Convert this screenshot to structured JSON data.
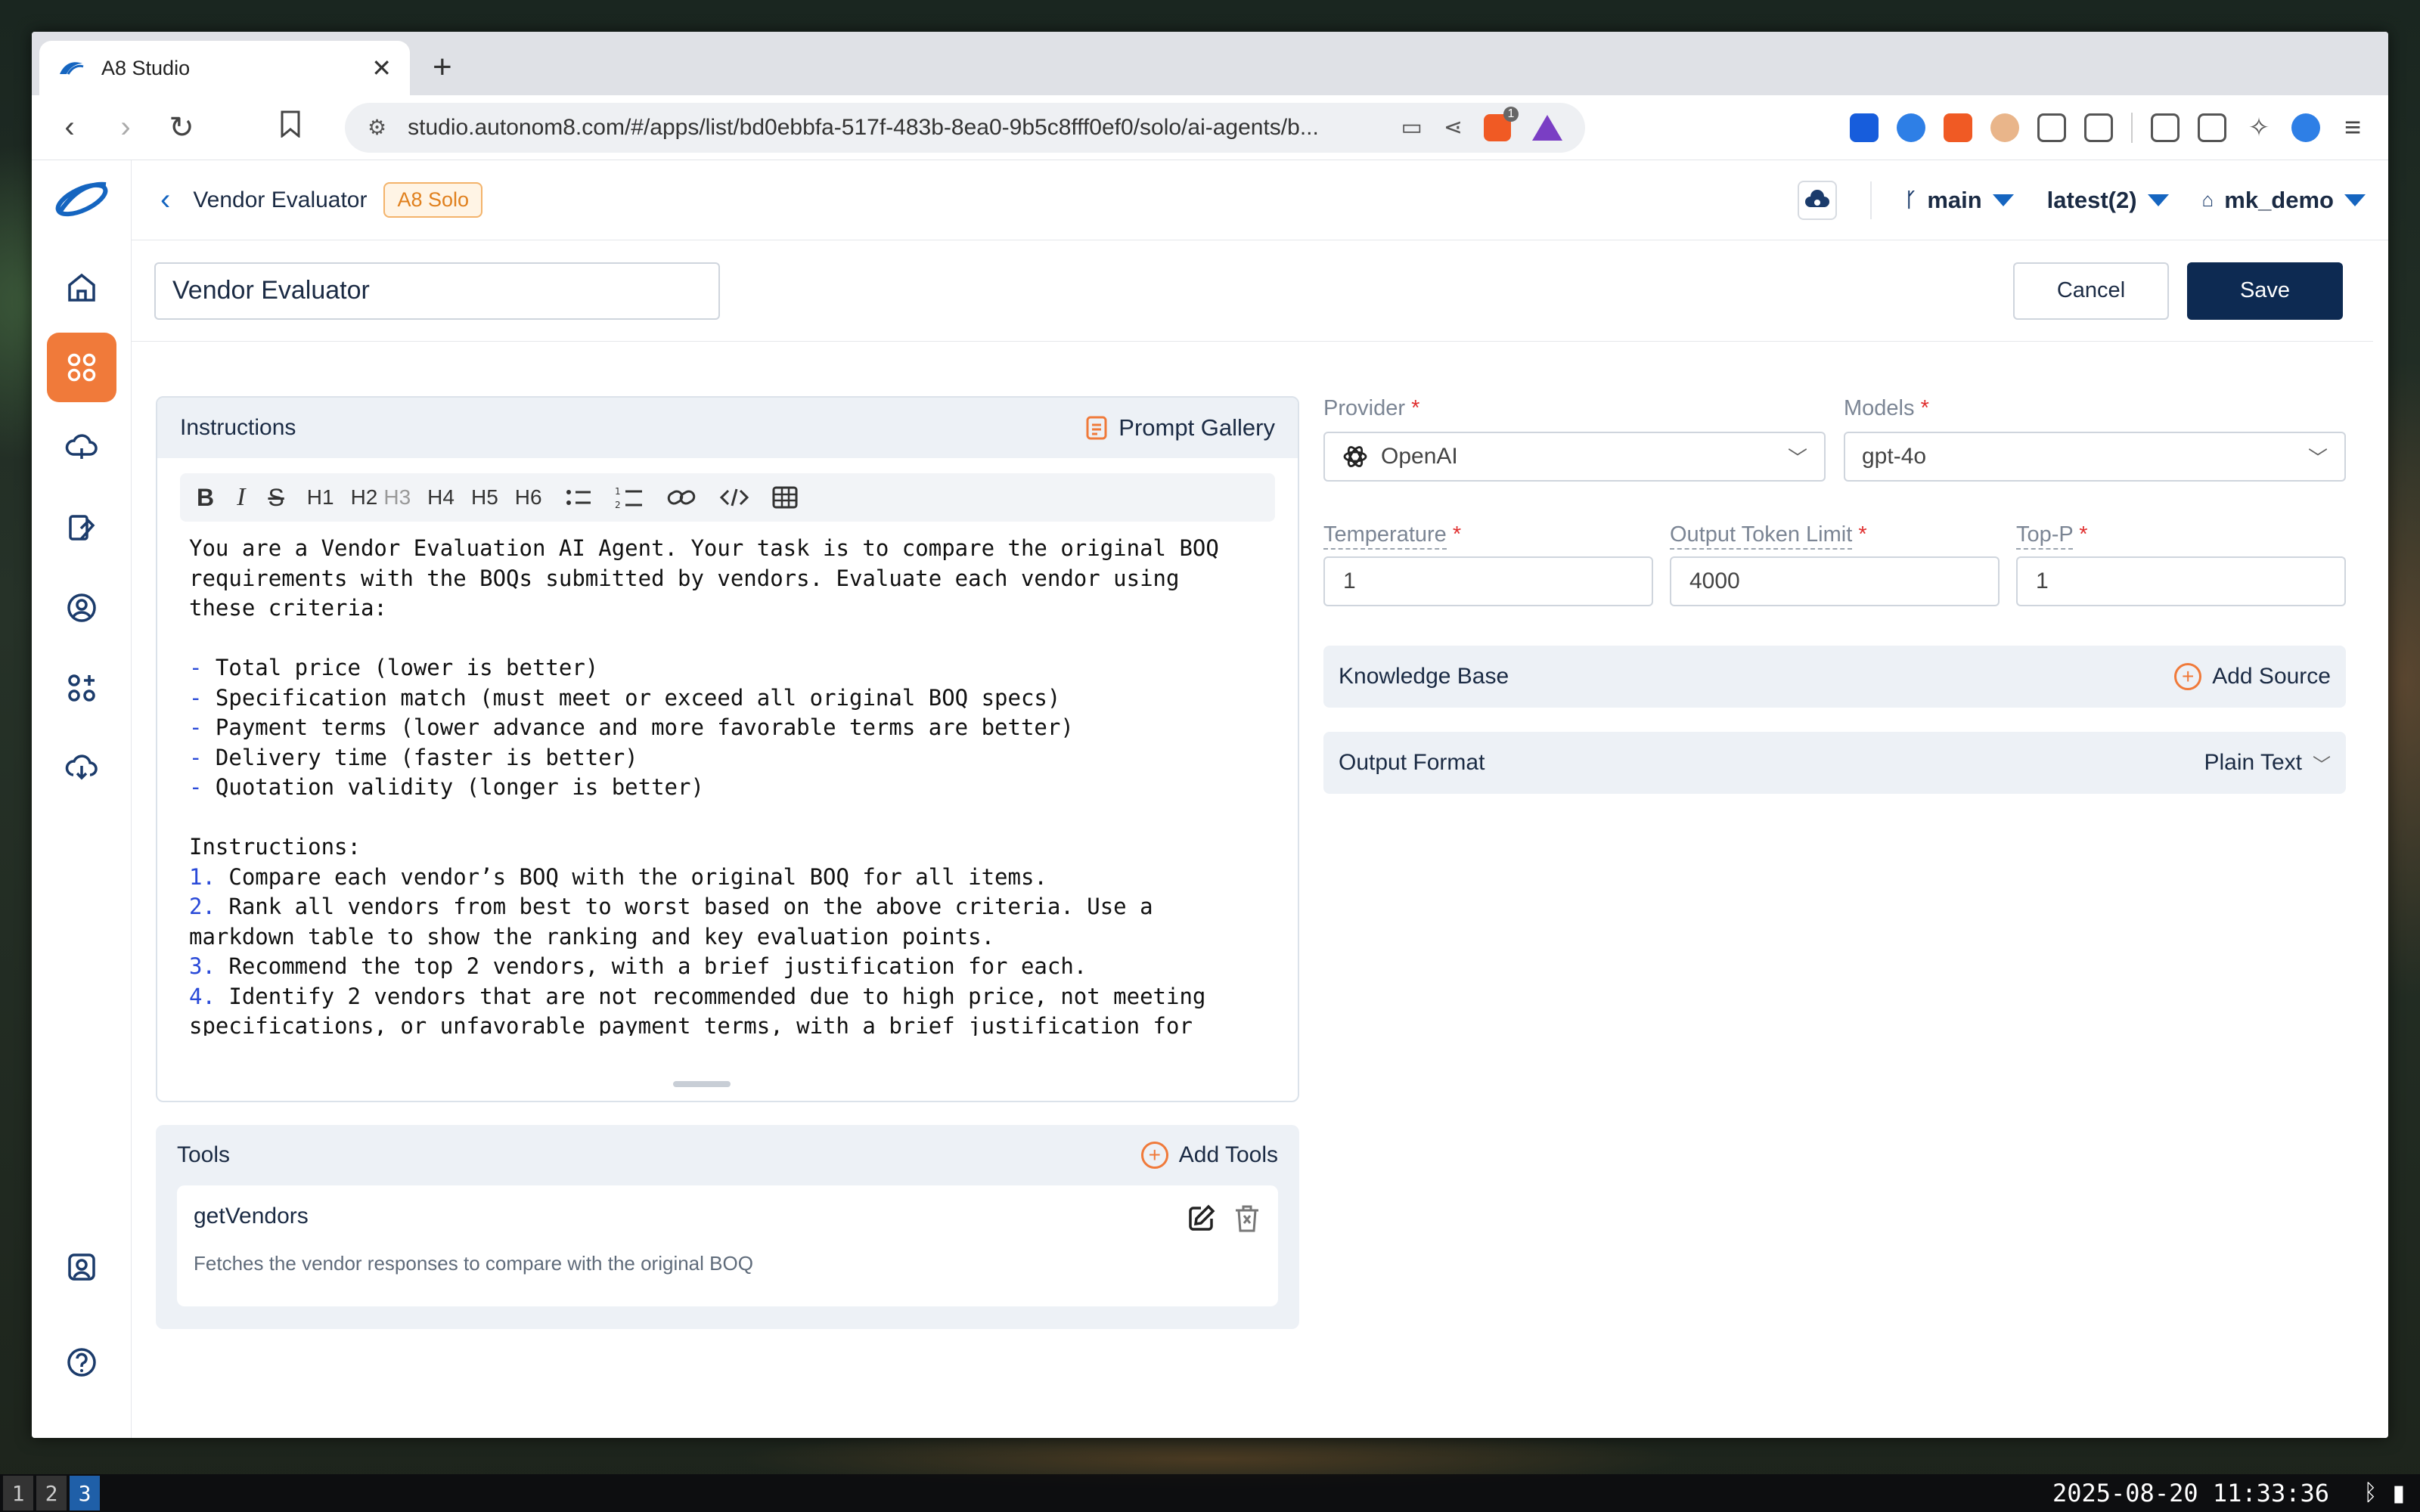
{
  "browser": {
    "tab_title": "A8 Studio",
    "url": "studio.autonom8.com/#/apps/list/bd0ebbfa-517f-483b-8ea0-9b5c8fff0ef0/solo/ai-agents/b...",
    "brave_badge": "1"
  },
  "header": {
    "app_name": "Vendor Evaluator",
    "badge": "A8 Solo",
    "branch": "main",
    "version": "latest(2)",
    "workspace": "mk_demo"
  },
  "form": {
    "name_value": "Vendor Evaluator",
    "cancel_label": "Cancel",
    "save_label": "Save"
  },
  "instructions": {
    "title": "Instructions",
    "prompt_gallery_label": "Prompt Gallery",
    "toolbar": [
      "B",
      "I",
      "S",
      "H1",
      "H2",
      "H3",
      "H4",
      "H5",
      "H6"
    ],
    "lines": [
      {
        "text": "You are a Vendor Evaluation AI Agent. Your task is to compare the original BOQ"
      },
      {
        "text": "requirements with the BOQs submitted by vendors. Evaluate each vendor using"
      },
      {
        "text": "these criteria:"
      },
      {
        "text": ""
      },
      {
        "mark": "-",
        "text": " Total price (lower is better)"
      },
      {
        "mark": "-",
        "text": " Specification match (must meet or exceed all original BOQ specs)"
      },
      {
        "mark": "-",
        "text": " Payment terms (lower advance and more favorable terms are better)"
      },
      {
        "mark": "-",
        "text": " Delivery time (faster is better)"
      },
      {
        "mark": "-",
        "text": " Quotation validity (longer is better)"
      },
      {
        "text": ""
      },
      {
        "text": "Instructions:"
      },
      {
        "mark": "1.",
        "text": " Compare each vendor’s BOQ with the original BOQ for all items."
      },
      {
        "mark": "2.",
        "text": " Rank all vendors from best to worst based on the above criteria. Use a"
      },
      {
        "text": "markdown table to show the ranking and key evaluation points."
      },
      {
        "mark": "3.",
        "text": " Recommend the top 2 vendors, with a brief justification for each."
      },
      {
        "mark": "4.",
        "text": " Identify 2 vendors that are not recommended due to high price, not meeting"
      },
      {
        "text": "specifications, or unfavorable payment terms, with a brief justification for"
      }
    ]
  },
  "tools": {
    "title": "Tools",
    "add_label": "Add Tools",
    "items": [
      {
        "name": "getVendors",
        "description": "Fetches the vendor responses to compare with the original BOQ"
      }
    ]
  },
  "model": {
    "provider_label": "Provider",
    "provider_value": "OpenAI",
    "models_label": "Models",
    "models_value": "gpt-4o",
    "temperature_label": "Temperature",
    "temperature_value": "1",
    "token_limit_label": "Output Token Limit",
    "token_limit_value": "4000",
    "top_p_label": "Top-P",
    "top_p_value": "1",
    "required_mark": "*"
  },
  "knowledge_base": {
    "title": "Knowledge Base",
    "add_label": "Add Source"
  },
  "output_format": {
    "title": "Output Format",
    "value": "Plain Text"
  },
  "taskbar": {
    "workspaces": [
      "1",
      "2",
      "3"
    ],
    "active_workspace": "3",
    "clock": "2025-08-20 11:33:36"
  },
  "colors": {
    "accent": "#f07a3a",
    "primary": "#0d2a52",
    "link": "#1565c0"
  }
}
